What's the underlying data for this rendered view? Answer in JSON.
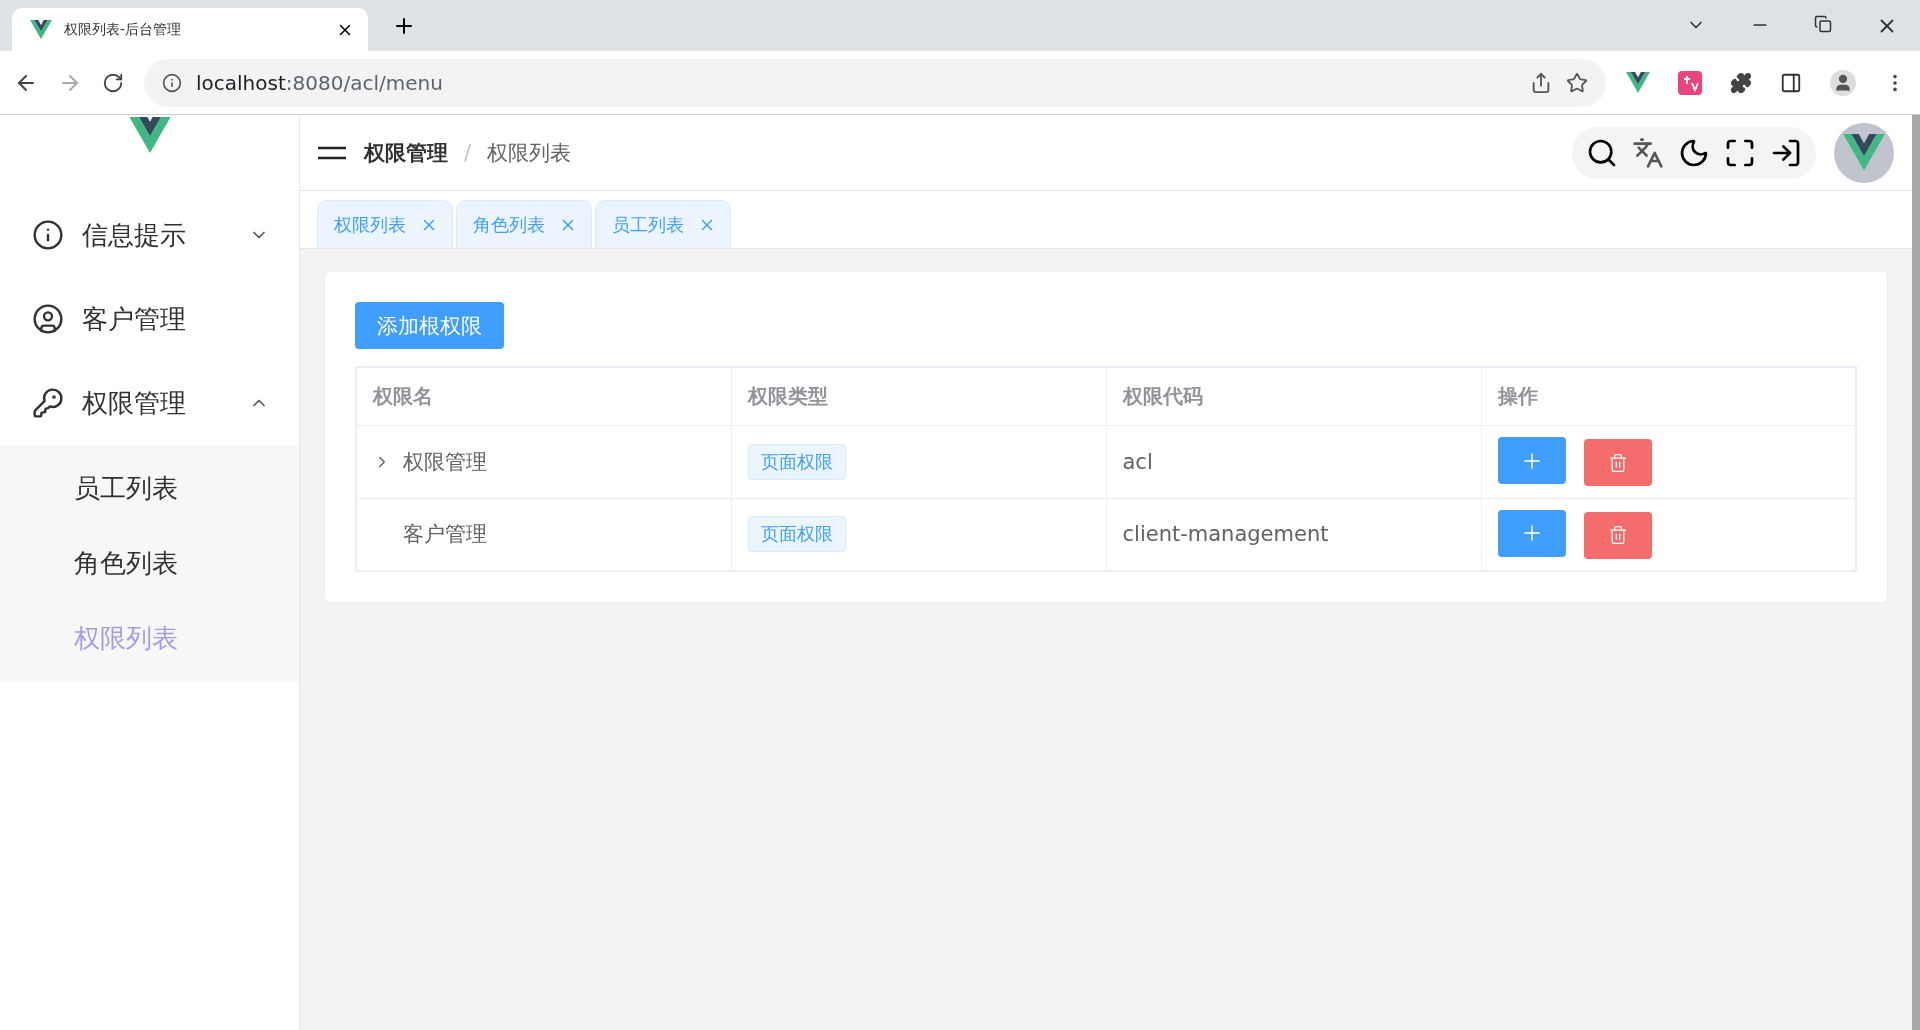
{
  "browser": {
    "tab_title": "权限列表-后台管理",
    "url_host": "localhost",
    "url_path": ":8080/acl/menu"
  },
  "sidebar": {
    "items": [
      {
        "label": "信息提示",
        "expanded": false
      },
      {
        "label": "客户管理"
      },
      {
        "label": "权限管理",
        "expanded": true,
        "children": [
          {
            "label": "员工列表",
            "selected": false
          },
          {
            "label": "角色列表",
            "selected": false
          },
          {
            "label": "权限列表",
            "selected": true
          }
        ]
      }
    ]
  },
  "header": {
    "breadcrumb": [
      "权限管理",
      "权限列表"
    ],
    "separator": "/"
  },
  "tabs": [
    {
      "label": "权限列表"
    },
    {
      "label": "角色列表"
    },
    {
      "label": "员工列表"
    }
  ],
  "add_button": "添加根权限",
  "table": {
    "columns": [
      "权限名",
      "权限类型",
      "权限代码",
      "操作"
    ],
    "rows": [
      {
        "name": "权限管理",
        "has_children": true,
        "type": "页面权限",
        "code": "acl"
      },
      {
        "name": "客户管理",
        "has_children": false,
        "type": "页面权限",
        "code": "client-management"
      }
    ]
  }
}
